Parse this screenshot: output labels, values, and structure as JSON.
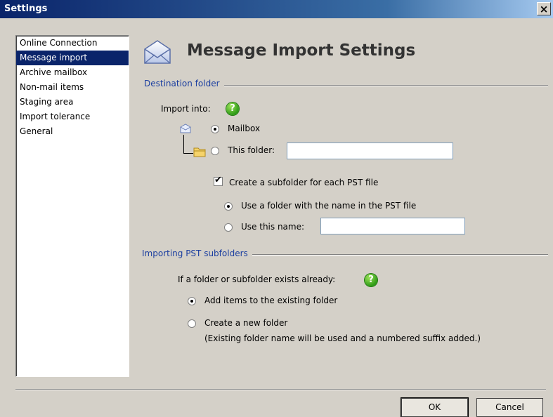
{
  "window": {
    "title": "Settings",
    "close_label": "×"
  },
  "nav": {
    "items": [
      {
        "label": "Online Connection",
        "selected": false
      },
      {
        "label": "Message import",
        "selected": true
      },
      {
        "label": "Archive mailbox",
        "selected": false
      },
      {
        "label": "Non-mail items",
        "selected": false
      },
      {
        "label": "Staging area",
        "selected": false
      },
      {
        "label": "Import tolerance",
        "selected": false
      },
      {
        "label": "General",
        "selected": false
      }
    ]
  },
  "header": {
    "title": "Message Import Settings",
    "icon": "envelope-icon"
  },
  "destination": {
    "group_label": "Destination folder",
    "import_into_label": "Import into:",
    "help_glyph": "?",
    "mailbox_label": "Mailbox",
    "mailbox_checked": true,
    "this_folder_label": "This folder:",
    "this_folder_checked": false,
    "this_folder_value": "",
    "subfolder_label": "Create a subfolder for each PST file",
    "subfolder_checked": true,
    "use_pst_name_label": "Use a folder with the name in the PST file",
    "use_pst_name_checked": true,
    "use_this_name_label": "Use this name:",
    "use_this_name_checked": false,
    "use_this_name_value": ""
  },
  "pst_subfolders": {
    "group_label": "Importing PST subfolders",
    "exists_label": "If a folder or subfolder exists already:",
    "help_glyph": "?",
    "add_items_label": "Add items to the existing folder",
    "add_items_checked": true,
    "create_new_label": "Create a new folder",
    "create_new_checked": false,
    "create_new_note": "(Existing folder name will be used and a numbered suffix added.)"
  },
  "buttons": {
    "ok_label": "OK",
    "cancel_label": "Cancel"
  },
  "colors": {
    "selection": "#0a246a",
    "group_title": "#1c3fa0",
    "help": "#2e9b16"
  }
}
